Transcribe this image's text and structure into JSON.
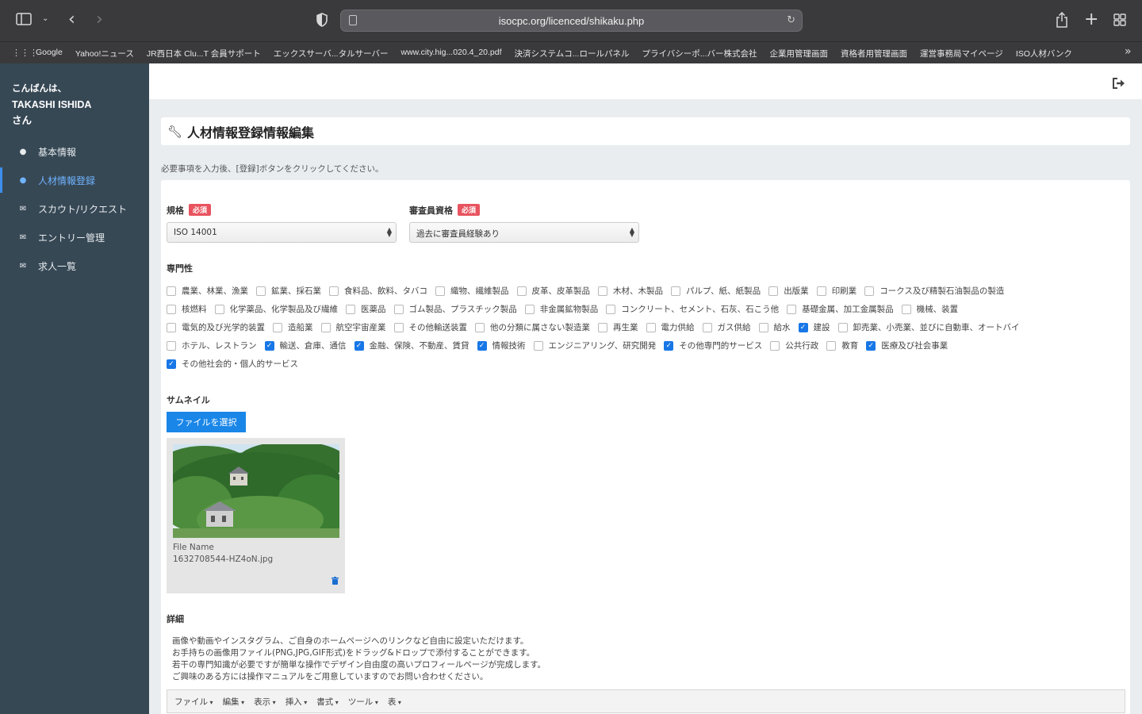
{
  "browser": {
    "url": "isocpc.org/licenced/shikaku.php",
    "bookmarks": [
      "Google",
      "Yahoo!ニュース",
      "JR西日本 Clu...T 会員サポート",
      "エックスサーバ...タルサーバー",
      "www.city.hig...020.4_20.pdf",
      "決済システムコ...ロールパネル",
      "プライバシーポ...バー株式会社",
      "企業用管理画面",
      "資格者用管理画面",
      "運営事務局マイページ",
      "ISO人材バンク"
    ]
  },
  "sidebar": {
    "greeting": "こんばんは、",
    "user_name": "TAKASHI ISHIDA",
    "honorific": "さん",
    "items": [
      {
        "label": "基本情報",
        "icon": "user-icon",
        "active": false
      },
      {
        "label": "人材情報登録",
        "icon": "user-icon",
        "active": true
      },
      {
        "label": "スカウト/リクエスト",
        "icon": "envelope-icon",
        "active": false
      },
      {
        "label": "エントリー管理",
        "icon": "envelope-icon",
        "active": false
      },
      {
        "label": "求人一覧",
        "icon": "envelope-icon",
        "active": false
      }
    ]
  },
  "page": {
    "title": "人材情報登録情報編集",
    "hint": "必要事項を入力後、[登録]ボタンをクリックしてください。"
  },
  "form": {
    "required_badge": "必須",
    "standard": {
      "label": "規格",
      "value": "ISO 14001"
    },
    "qualification": {
      "label": "審査員資格",
      "value": "過去に審査員経験あり"
    },
    "specialty": {
      "label": "専門性",
      "rows": [
        [
          {
            "label": "農業、林業、漁業",
            "checked": false
          },
          {
            "label": "鉱業、採石業",
            "checked": false
          },
          {
            "label": "食料品、飲料、タバコ",
            "checked": false
          },
          {
            "label": "織物、繊維製品",
            "checked": false
          },
          {
            "label": "皮革、皮革製品",
            "checked": false
          },
          {
            "label": "木材、木製品",
            "checked": false
          },
          {
            "label": "パルプ、紙、紙製品",
            "checked": false
          },
          {
            "label": "出版業",
            "checked": false
          },
          {
            "label": "印刷業",
            "checked": false
          },
          {
            "label": "コークス及び精製石油製品の製造",
            "checked": false
          }
        ],
        [
          {
            "label": "核燃料",
            "checked": false
          },
          {
            "label": "化学薬品、化学製品及び繊維",
            "checked": false
          },
          {
            "label": "医薬品",
            "checked": false
          },
          {
            "label": "ゴム製品、プラスチック製品",
            "checked": false
          },
          {
            "label": "非金属鉱物製品",
            "checked": false
          },
          {
            "label": "コンクリート、セメント、石灰、石こう他",
            "checked": false
          },
          {
            "label": "基礎金属、加工金属製品",
            "checked": false
          },
          {
            "label": "機械、装置",
            "checked": false
          }
        ],
        [
          {
            "label": "電気的及び光学的装置",
            "checked": false
          },
          {
            "label": "造船業",
            "checked": false
          },
          {
            "label": "航空宇宙産業",
            "checked": false
          },
          {
            "label": "その他輸送装置",
            "checked": false
          },
          {
            "label": "他の分類に属さない製造業",
            "checked": false
          },
          {
            "label": "再生業",
            "checked": false
          },
          {
            "label": "電力供給",
            "checked": false
          },
          {
            "label": "ガス供給",
            "checked": false
          },
          {
            "label": "給水",
            "checked": false
          },
          {
            "label": "建設",
            "checked": true
          },
          {
            "label": "卸売業、小売業、並びに自動車、オートバイ",
            "checked": false
          }
        ],
        [
          {
            "label": "ホテル、レストラン",
            "checked": false
          },
          {
            "label": "輸送、倉庫、通信",
            "checked": true
          },
          {
            "label": "金融、保険、不動産、賃貸",
            "checked": true
          },
          {
            "label": "情報技術",
            "checked": true
          },
          {
            "label": "エンジニアリング、研究開発",
            "checked": false
          },
          {
            "label": "その他専門的サービス",
            "checked": true
          },
          {
            "label": "公共行政",
            "checked": false
          },
          {
            "label": "教育",
            "checked": false
          },
          {
            "label": "医療及び社会事業",
            "checked": true
          }
        ],
        [
          {
            "label": "その他社会的・個人的サービス",
            "checked": true
          }
        ]
      ]
    },
    "thumbnail": {
      "label": "サムネイル",
      "button": "ファイルを選択",
      "file_name_label": "File Name",
      "file_name": "1632708544-HZ4oN.jpg"
    },
    "detail": {
      "label": "詳細",
      "lines": [
        "画像や動画やインスタグラム、ご自身のホームページへのリンクなど自由に設定いただけます。",
        "お手持ちの画像用ファイル(PNG,JPG,GIF形式)をドラッグ&ドロップで添付することができます。",
        "若干の専門知識が必要ですが簡単な操作でデザイン自由度の高いプロフィールページが完成します。",
        "ご興味のある方には操作マニュアルをご用意していますのでお問い合わせください。"
      ],
      "editor_menu": [
        "ファイル",
        "編集",
        "表示",
        "挿入",
        "書式",
        "ツール",
        "表"
      ]
    }
  }
}
